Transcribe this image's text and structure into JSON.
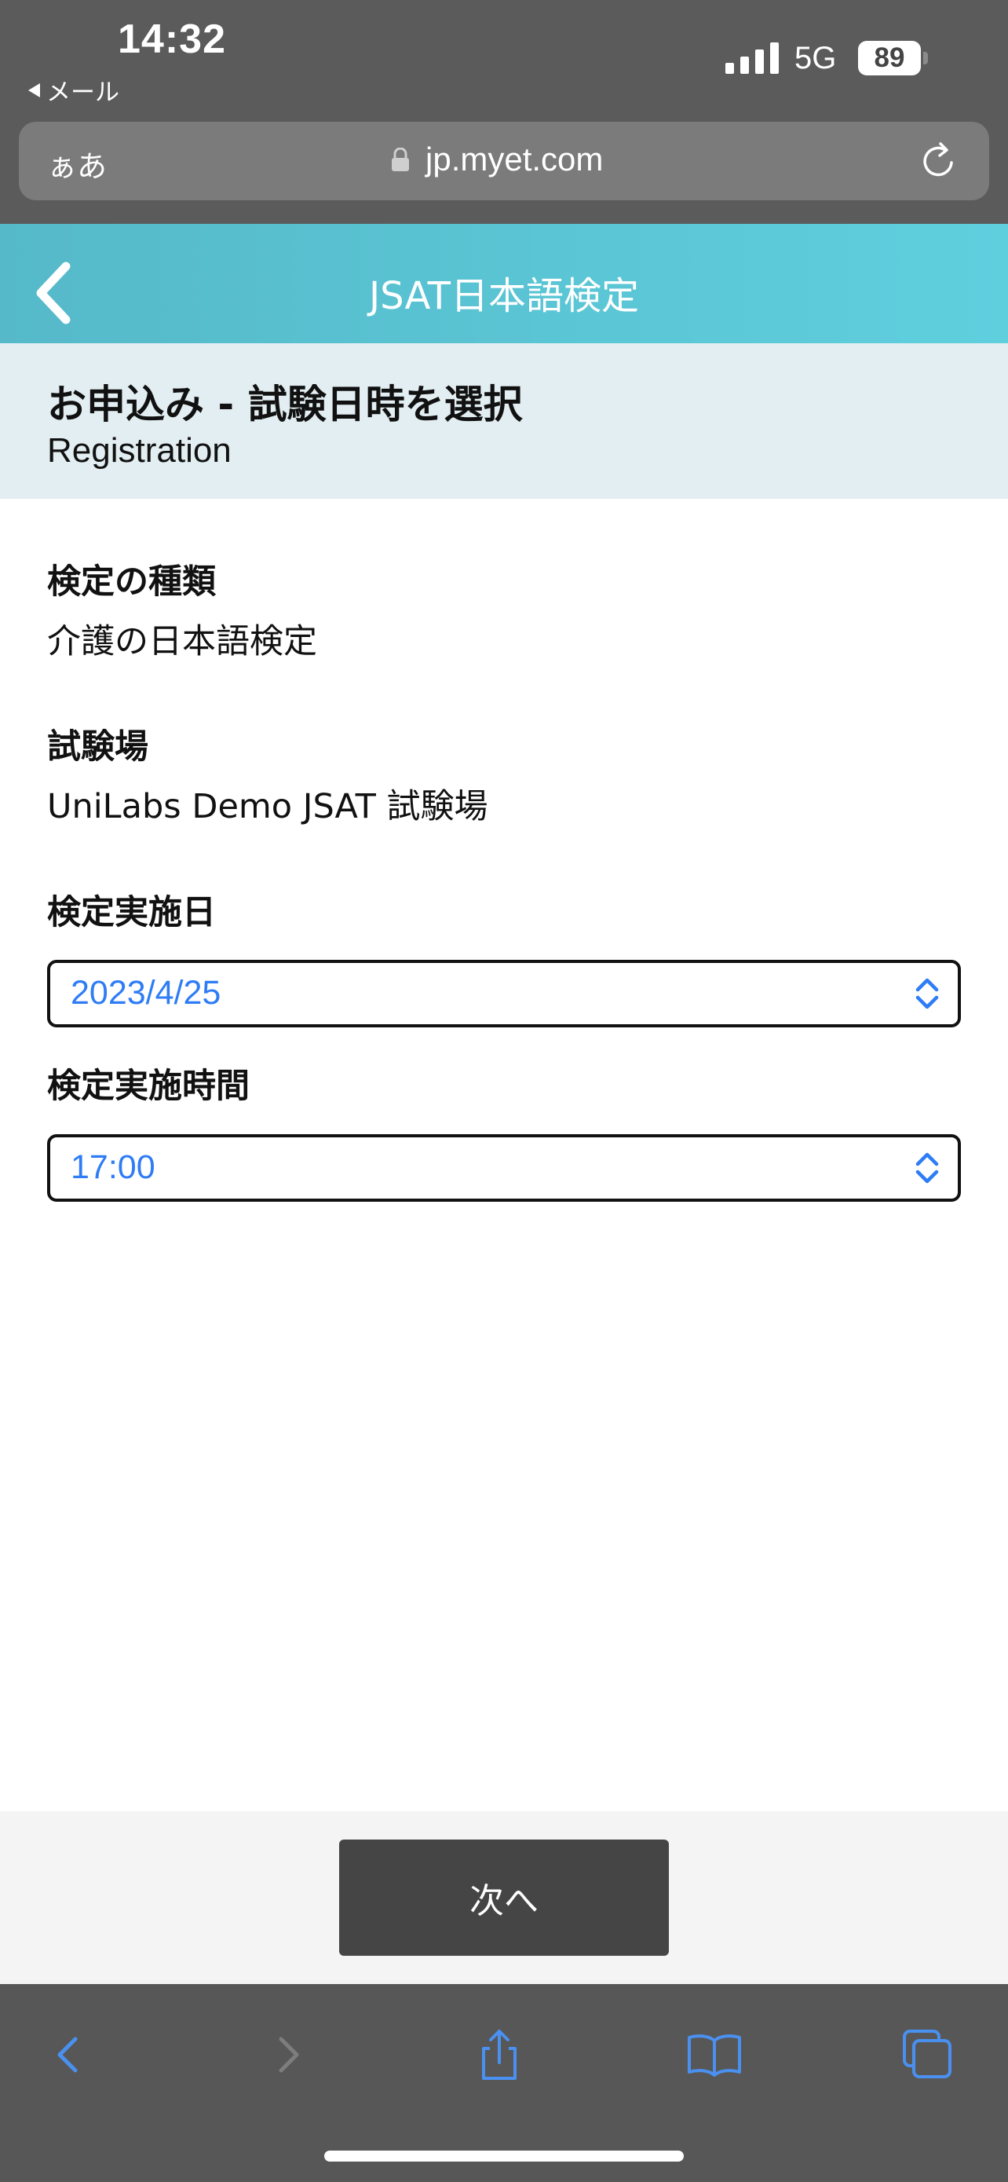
{
  "status_bar": {
    "time": "14:32",
    "back_app": "メール",
    "network": "5G",
    "battery": "89"
  },
  "browser": {
    "text_size_label": "ぁあ",
    "url": "jp.myet.com"
  },
  "header": {
    "title": "JSAT日本語検定"
  },
  "page": {
    "title": "お申込み - 試験日時を選択",
    "subtitle": "Registration"
  },
  "form": {
    "exam_type_label": "検定の種類",
    "exam_type_value": "介護の日本語検定",
    "venue_label": "試験場",
    "venue_value": "UniLabs Demo JSAT 試験場",
    "date_label": "検定実施日",
    "date_value": "2023/4/25",
    "time_label": "検定実施時間",
    "time_value": "17:00"
  },
  "actions": {
    "next_label": "次へ"
  },
  "colors": {
    "header_bg": "#5fcfde",
    "heading_band_bg": "#e3eef2",
    "select_text": "#2e7cf6",
    "toolbar_icon": "#4a90f0",
    "button_bg": "#454545"
  }
}
